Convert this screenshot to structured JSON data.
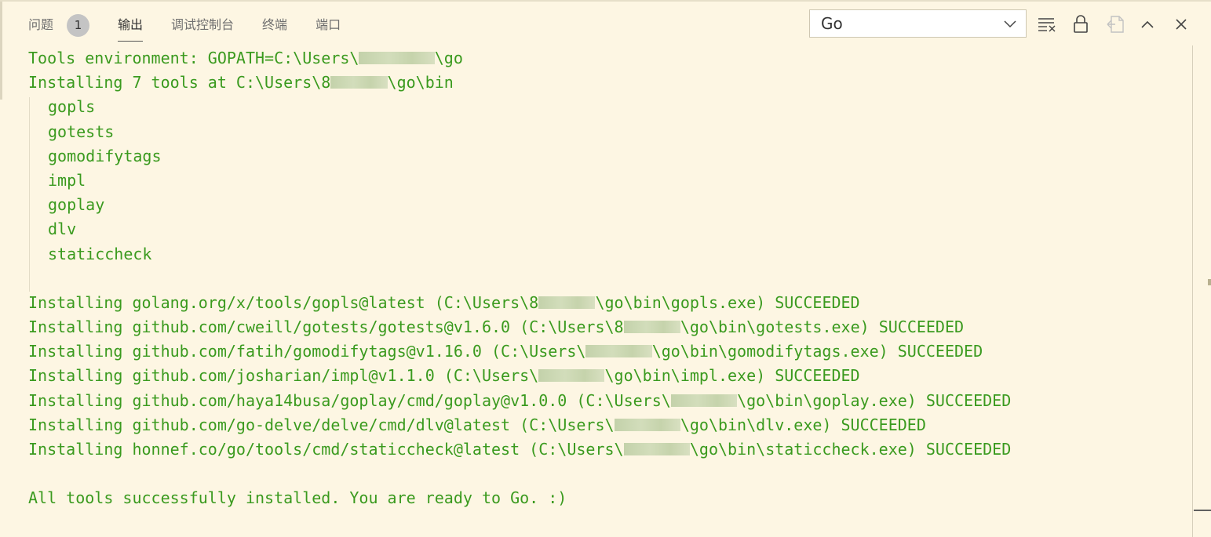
{
  "tabs": [
    {
      "label": "问题",
      "badge": "1",
      "active": false
    },
    {
      "label": "输出",
      "active": true
    },
    {
      "label": "调试控制台",
      "active": false
    },
    {
      "label": "终端",
      "active": false
    },
    {
      "label": "端口",
      "active": false
    }
  ],
  "toolbar": {
    "channel_select": {
      "value": "Go"
    },
    "icons": [
      "clear-output-icon",
      "lock-scroll-icon",
      "open-in-editor-icon",
      "maximize-panel-icon",
      "close-panel-icon"
    ]
  },
  "output": {
    "text_color": "#3a9a1e",
    "lines": [
      {
        "text": "Tools environment: GOPATH=C:\\Users\\",
        "redacted": "        ",
        "rest": "\\go"
      },
      {
        "text": "Installing 7 tools at C:\\Users\\8",
        "redacted": "      ",
        "rest": "\\go\\bin"
      },
      {
        "text": "gopls",
        "indent": true
      },
      {
        "text": "gotests",
        "indent": true
      },
      {
        "text": "gomodifytags",
        "indent": true
      },
      {
        "text": "impl",
        "indent": true
      },
      {
        "text": "goplay",
        "indent": true
      },
      {
        "text": "dlv",
        "indent": true
      },
      {
        "text": "staticcheck",
        "indent": true
      },
      {
        "text": ""
      },
      {
        "text": "Installing golang.org/x/tools/gopls@latest (C:\\Users\\8",
        "redacted": "      ",
        "rest": "\\go\\bin\\gopls.exe) SUCCEEDED"
      },
      {
        "text": "Installing github.com/cweill/gotests/gotests@v1.6.0 (C:\\Users\\8",
        "redacted": "      ",
        "rest": "\\go\\bin\\gotests.exe) SUCCEEDED"
      },
      {
        "text": "Installing github.com/fatih/gomodifytags@v1.16.0 (C:\\Users\\",
        "redacted": "       ",
        "rest": "\\go\\bin\\gomodifytags.exe) SUCCEEDED"
      },
      {
        "text": "Installing github.com/josharian/impl@v1.1.0 (C:\\Users\\",
        "redacted": "       ",
        "rest": "\\go\\bin\\impl.exe) SUCCEEDED"
      },
      {
        "text": "Installing github.com/haya14busa/goplay/cmd/goplay@v1.0.0 (C:\\Users\\",
        "redacted": "       ",
        "rest": "\\go\\bin\\goplay.exe) SUCCEEDED"
      },
      {
        "text": "Installing github.com/go-delve/delve/cmd/dlv@latest (C:\\Users\\",
        "redacted": "       ",
        "rest": "\\go\\bin\\dlv.exe) SUCCEEDED"
      },
      {
        "text": "Installing honnef.co/go/tools/cmd/staticcheck@latest (C:\\Users\\",
        "redacted": "       ",
        "rest": "\\go\\bin\\staticcheck.exe) SUCCEEDED"
      },
      {
        "text": ""
      },
      {
        "text": "All tools successfully installed. You are ready to Go. :)"
      }
    ]
  }
}
